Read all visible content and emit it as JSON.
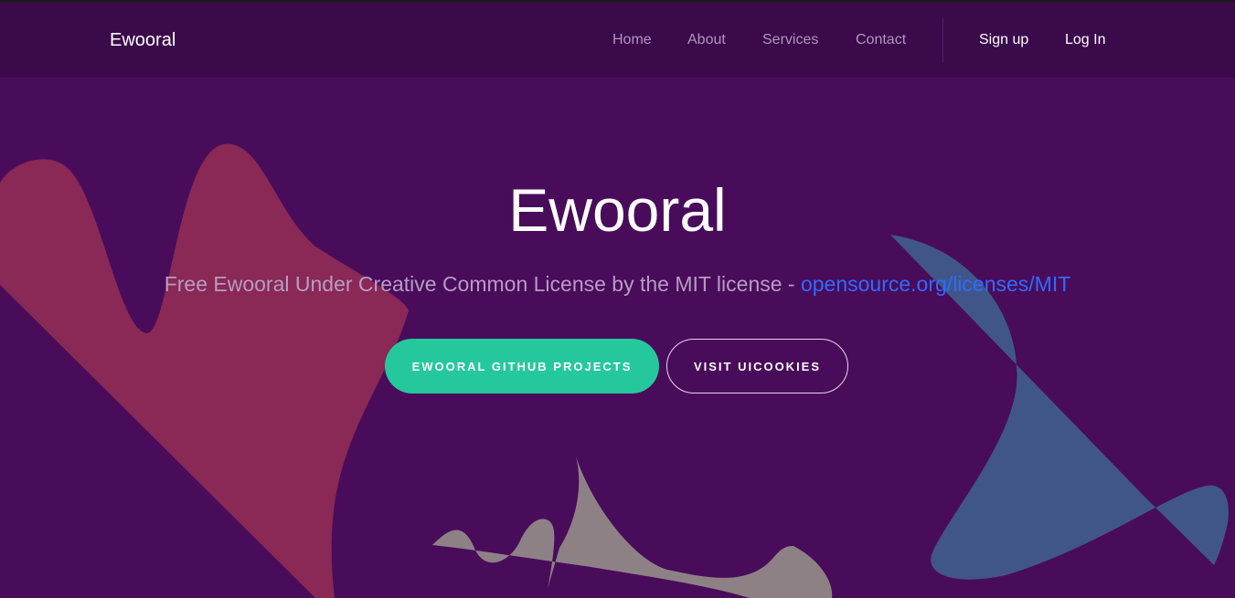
{
  "colors": {
    "background": "#490c5b",
    "navbar": "#3b0a4b",
    "accent_green": "#25c89d",
    "link_blue": "#2f6bff",
    "shape_red": "#8a2856",
    "shape_blue": "#405689",
    "shape_gray": "#8e8185"
  },
  "navbar": {
    "brand": "Ewooral",
    "links": [
      {
        "label": "Home"
      },
      {
        "label": "About"
      },
      {
        "label": "Services"
      },
      {
        "label": "Contact"
      }
    ],
    "auth": {
      "signup": "Sign up",
      "login": "Log In"
    }
  },
  "hero": {
    "title": "Ewooral",
    "subtitle_text": "Free Ewooral Under Creative Common License by the MIT license - ",
    "subtitle_link": "opensource.org/licenses/MIT",
    "buttons": {
      "primary": "EWOORAL GITHUB PROJECTS",
      "secondary": "VISIT UICOOKIES"
    }
  }
}
